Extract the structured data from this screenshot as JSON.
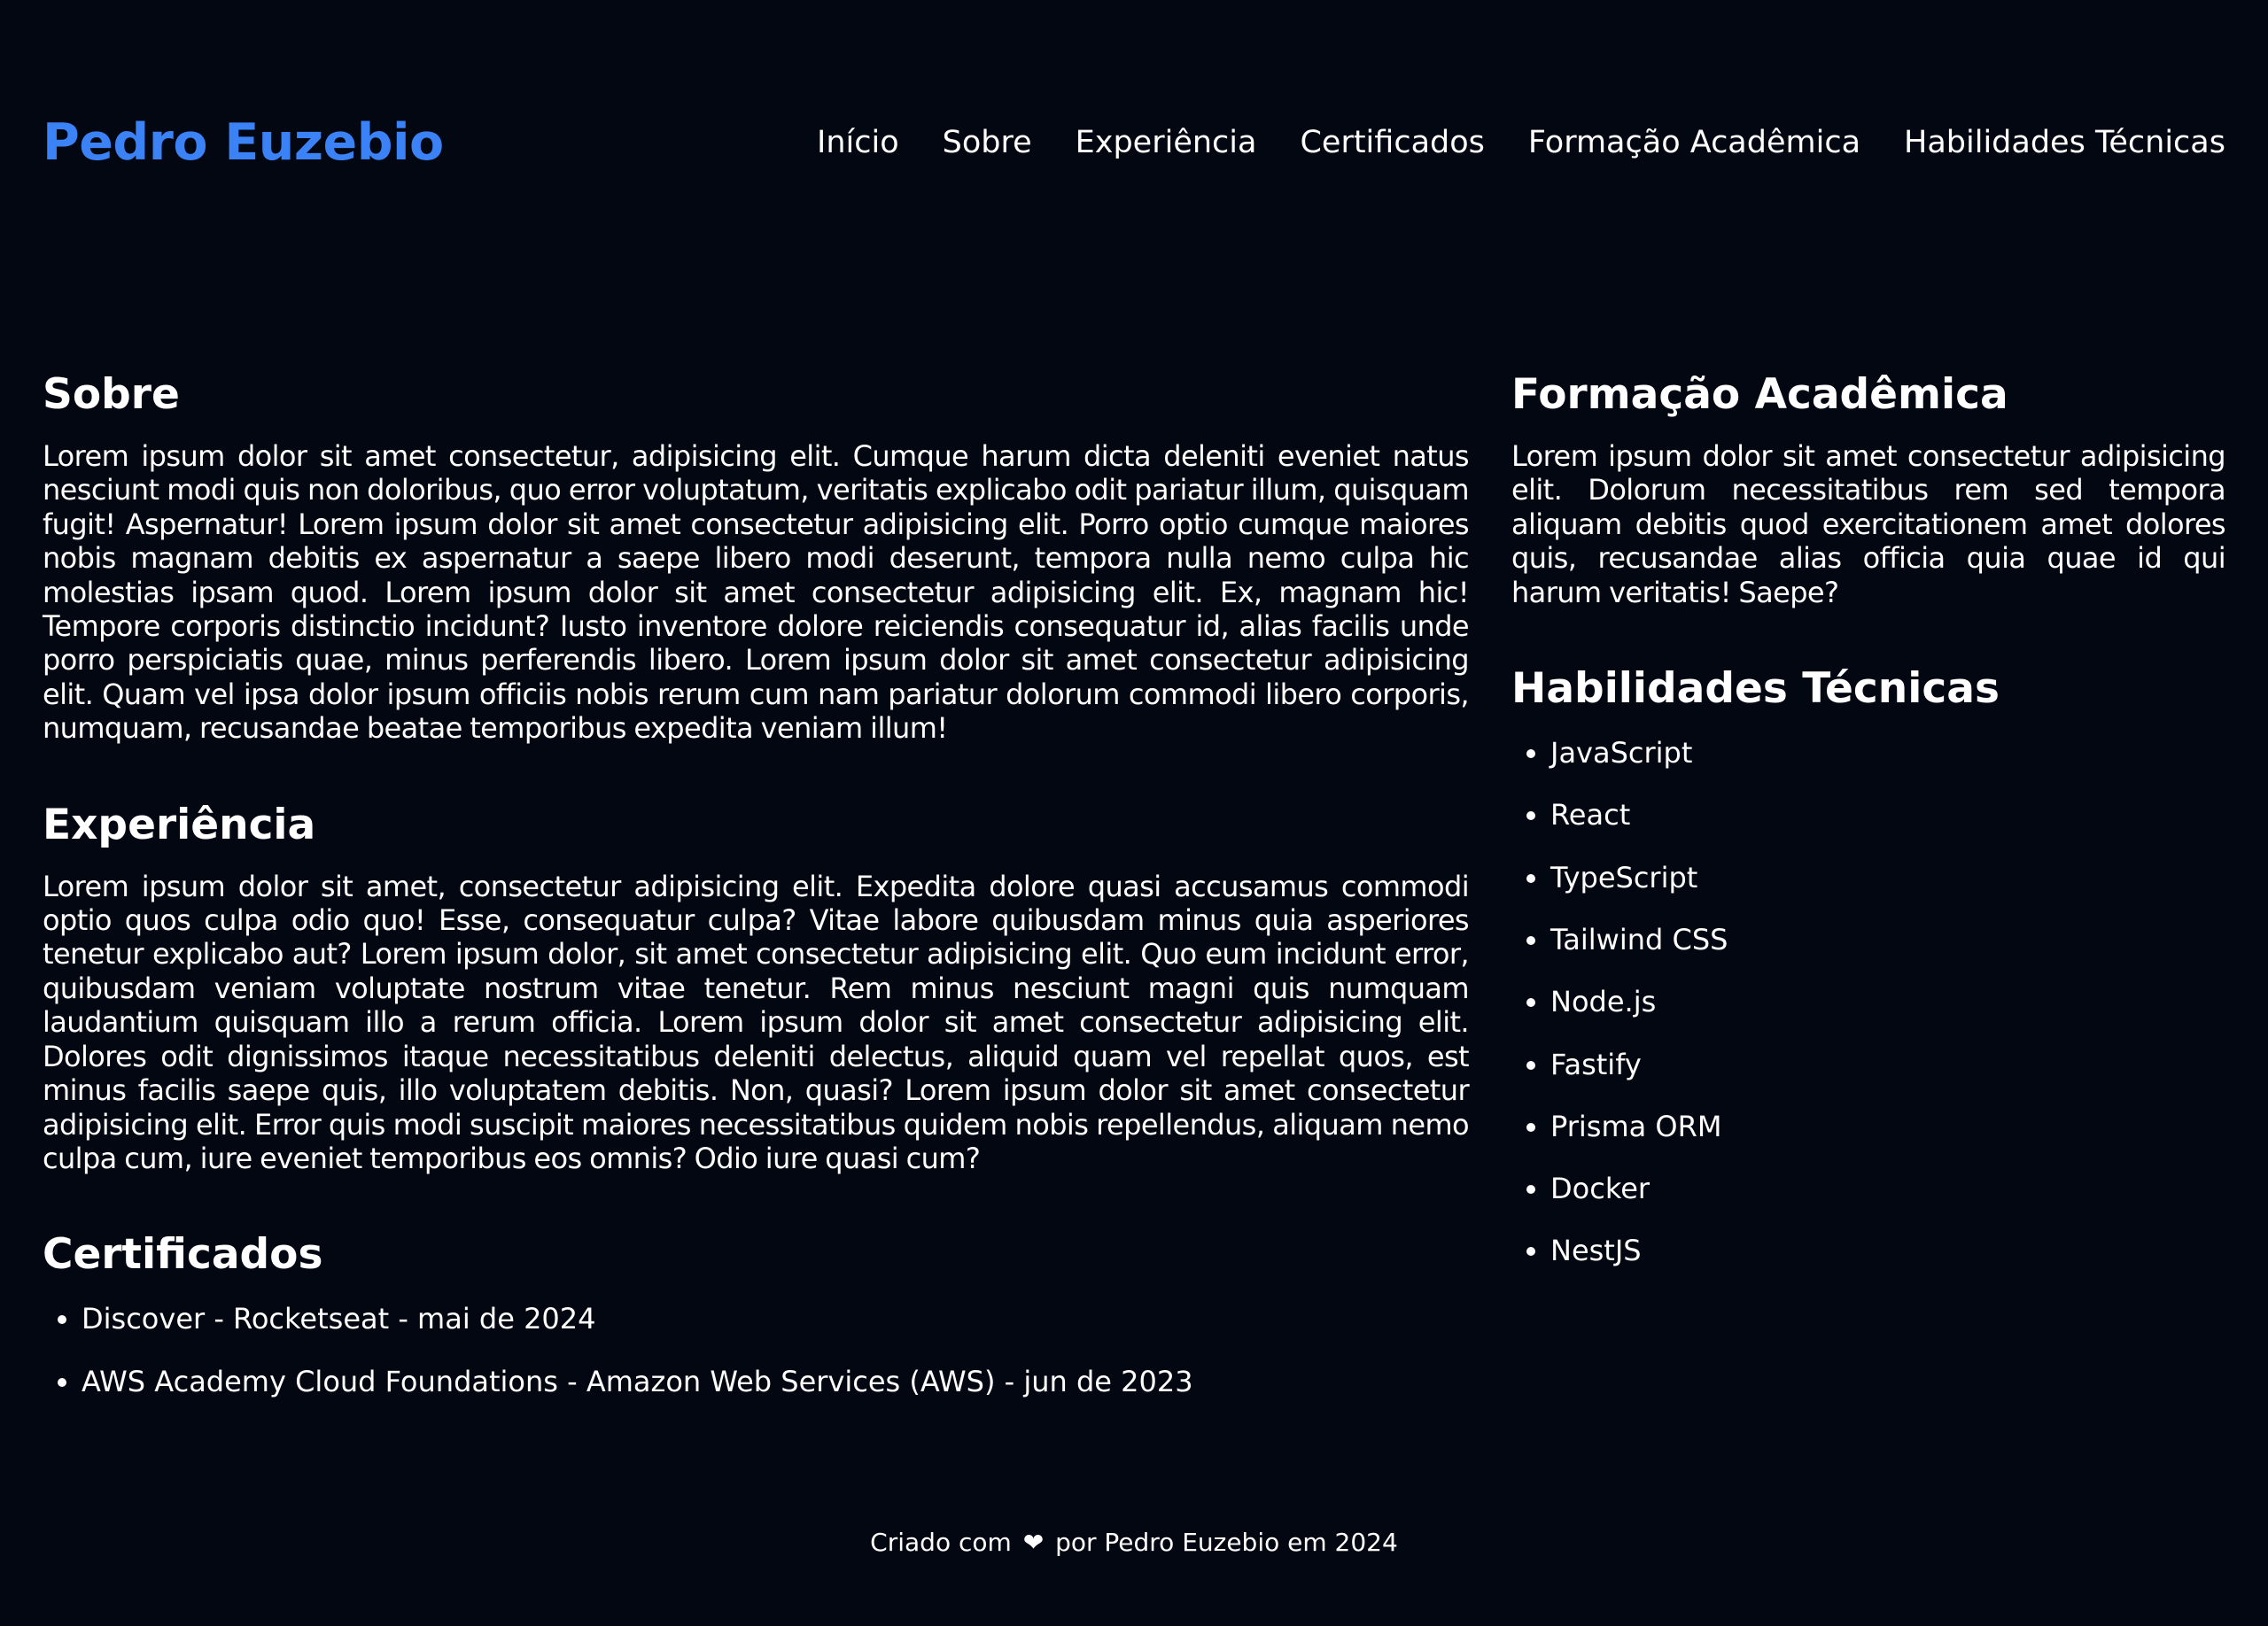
{
  "header": {
    "brand": "Pedro Euzebio",
    "nav": [
      "Início",
      "Sobre",
      "Experiência",
      "Certificados",
      "Formação Acadêmica",
      "Habilidades Técnicas"
    ]
  },
  "sobre": {
    "title": "Sobre",
    "text": "Lorem ipsum dolor sit amet consectetur, adipisicing elit. Cumque harum dicta deleniti eveniet natus nesciunt modi quis non doloribus, quo error voluptatum, veritatis explicabo odit pariatur illum, quisquam fugit! Aspernatur! Lorem ipsum dolor sit amet consectetur adipisicing elit. Porro optio cumque maiores nobis magnam debitis ex aspernatur a saepe libero modi deserunt, tempora nulla nemo culpa hic molestias ipsam quod. Lorem ipsum dolor sit amet consectetur adipisicing elit. Ex, magnam hic! Tempore corporis distinctio incidunt? Iusto inventore dolore reiciendis consequatur id, alias facilis unde porro perspiciatis quae, minus perferendis libero. Lorem ipsum dolor sit amet consectetur adipisicing elit. Quam vel ipsa dolor ipsum officiis nobis rerum cum nam pariatur dolorum commodi libero corporis, numquam, recusandae beatae temporibus expedita veniam illum!"
  },
  "experiencia": {
    "title": "Experiência",
    "text": "Lorem ipsum dolor sit amet, consectetur adipisicing elit. Expedita dolore quasi accusamus commodi optio quos culpa odio quo! Esse, consequatur culpa? Vitae labore quibusdam minus quia asperiores tenetur explicabo aut? Lorem ipsum dolor, sit amet consectetur adipisicing elit. Quo eum incidunt error, quibusdam veniam voluptate nostrum vitae tenetur. Rem minus nesciunt magni quis numquam laudantium quisquam illo a rerum officia. Lorem ipsum dolor sit amet consectetur adipisicing elit. Dolores odit dignissimos itaque necessitatibus deleniti delectus, aliquid quam vel repellat quos, est minus facilis saepe quis, illo voluptatem debitis. Non, quasi? Lorem ipsum dolor sit amet consectetur adipisicing elit. Error quis modi suscipit maiores necessitatibus quidem nobis repellendus, aliquam nemo culpa cum, iure eveniet temporibus eos omnis? Odio iure quasi cum?"
  },
  "certificados": {
    "title": "Certificados",
    "items": [
      "Discover - Rocketseat - mai de 2024",
      "AWS Academy Cloud Foundations - Amazon Web Services (AWS) - jun de 2023"
    ]
  },
  "formacao": {
    "title": "Formação Acadêmica",
    "text": "Lorem ipsum dolor sit amet consectetur adipisicing elit. Dolorum necessitatibus rem sed tempora aliquam debitis quod exercitationem amet dolores quis, recusandae alias officia quia quae id qui harum veritatis! Saepe?"
  },
  "habilidades": {
    "title": "Habilidades Técnicas",
    "items": [
      "JavaScript",
      "React",
      "TypeScript",
      "Tailwind CSS",
      "Node.js",
      "Fastify",
      "Prisma ORM",
      "Docker",
      "NestJS"
    ]
  },
  "footer": {
    "before": "Criado com",
    "heart_icon": "heart-icon",
    "after": "por Pedro Euzebio em 2024"
  },
  "colors": {
    "background": "#030712",
    "brand": "#3b82f6",
    "text": "#ffffff"
  }
}
